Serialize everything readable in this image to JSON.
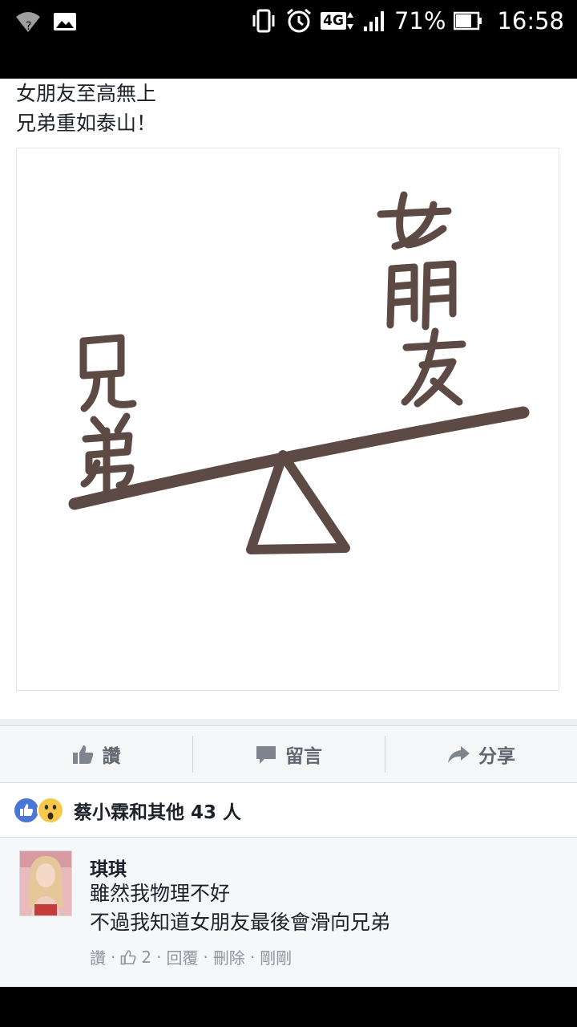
{
  "status_bar": {
    "network": "4G",
    "battery_percent": "71%",
    "time": "16:58"
  },
  "post": {
    "text_lines": [
      "女朋友至高無上",
      "兄弟重如泰山！"
    ]
  },
  "actions": {
    "like": "讚",
    "comment": "留言",
    "share": "分享"
  },
  "reactions": {
    "summary": "蔡小霖和其他 43 人"
  },
  "comment": {
    "author": "琪琪",
    "lines": [
      "雖然我物理不好",
      "不過我知道女朋友最後會滑向兄弟"
    ],
    "like_label": "讚",
    "like_count": "2",
    "reply_label": "回覆",
    "delete_label": "刪除",
    "time": "剛剛"
  }
}
